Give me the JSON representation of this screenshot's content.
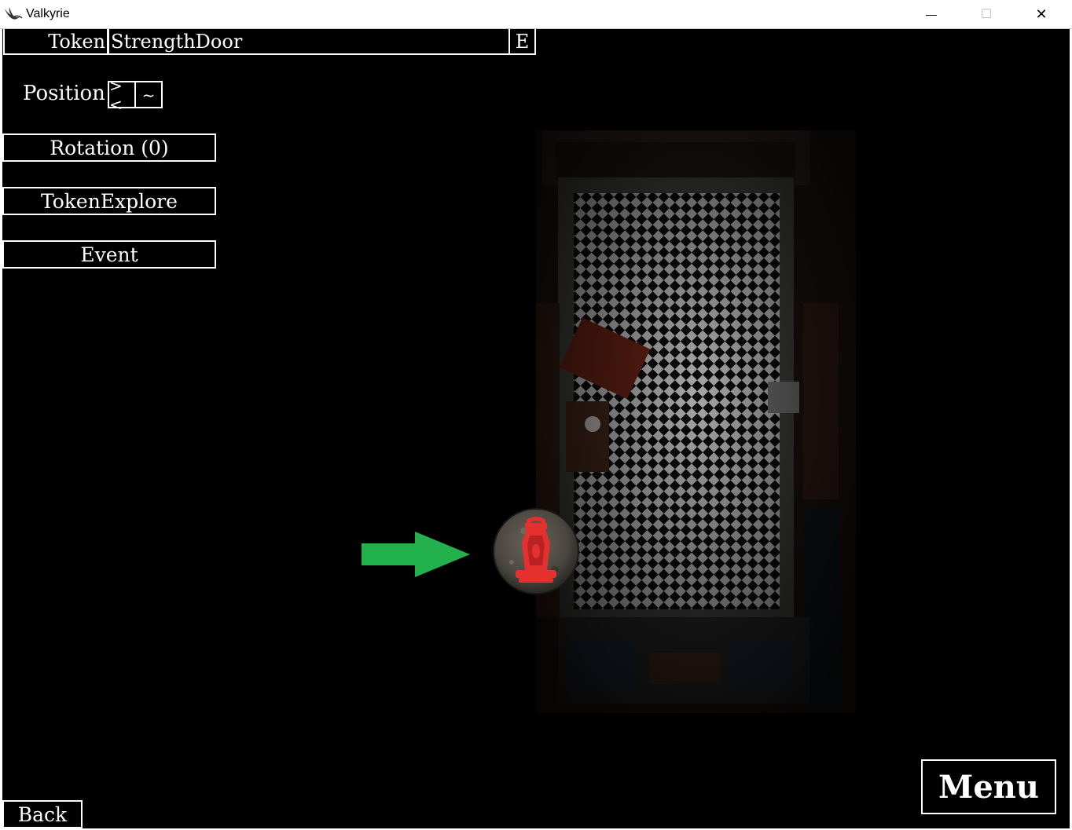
{
  "window": {
    "title": "Valkyrie",
    "minimize_glyph": "—",
    "maximize_glyph": "☐",
    "close_glyph": "✕"
  },
  "editor": {
    "token_label": "Token",
    "token_name": "StrengthDoor",
    "edit_button": "E",
    "position_label": "Position",
    "position_snap_button": "><",
    "position_free_button": "~",
    "rotation_button": "Rotation (0)",
    "type_button": "TokenExplore",
    "event_button": "Event"
  },
  "footer": {
    "back_button": "Back",
    "menu_button": "Menu"
  },
  "scene": {
    "token_icon": "lantern-icon",
    "pointer_icon": "arrow-right-icon",
    "arrow_color": "#22b14c",
    "token_color": "#e53030"
  }
}
